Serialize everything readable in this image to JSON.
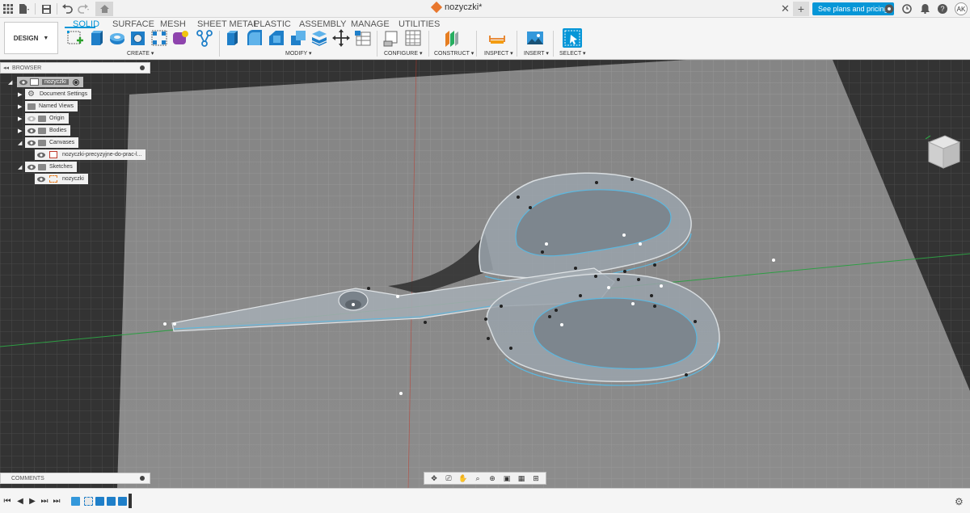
{
  "titlebar": {
    "document_title": "nozyczki*",
    "plans_button": "See plans and pricing",
    "user_initials": "AK"
  },
  "ribbon": {
    "design_button": "DESIGN",
    "tabs": [
      "SOLID",
      "SURFACE",
      "MESH",
      "SHEET METAL",
      "PLASTIC",
      "ASSEMBLY",
      "MANAGE",
      "UTILITIES"
    ],
    "active_tab": "SOLID",
    "groups": {
      "create": "CREATE",
      "modify": "MODIFY",
      "configure": "CONFIGURE",
      "construct": "CONSTRUCT",
      "inspect": "INSPECT",
      "insert": "INSERT",
      "select": "SELECT"
    }
  },
  "browser": {
    "title": "BROWSER",
    "root": "nozyczki",
    "nodes": [
      {
        "label": "Document Settings"
      },
      {
        "label": "Named Views"
      },
      {
        "label": "Origin"
      },
      {
        "label": "Bodies"
      },
      {
        "label": "Canvases"
      },
      {
        "label": "nozyczki-precyzyjne-do-prac-l..."
      },
      {
        "label": "Sketches"
      },
      {
        "label": "nozyczki"
      }
    ]
  },
  "comments": {
    "title": "COMMENTS"
  },
  "colors": {
    "accent": "#0696d7",
    "viewport_bg": "#3a3a3a",
    "ground_plane": "#8a8a8a",
    "scissors_fill": "#9aa3ab",
    "scissors_edge": "#5cb8e0",
    "grid_line": "#9b9b9b",
    "x_axis": "#c0392b",
    "y_axis": "#2e9e44"
  }
}
